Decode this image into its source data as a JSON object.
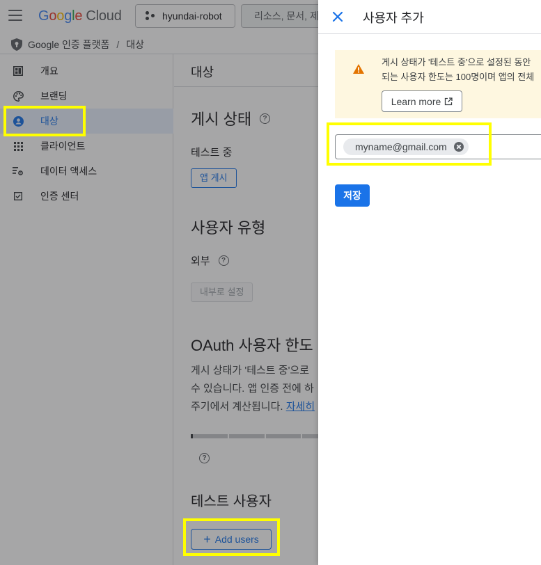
{
  "topbar": {
    "logo_word": "Google",
    "logo_cloud": "Cloud",
    "project": "hyundai-robot",
    "search_placeholder": "리소스, 문서, 제품"
  },
  "breadcrumb": {
    "items": [
      "Google 인증 플랫폼",
      "대상"
    ],
    "separator": "/"
  },
  "sidebar": {
    "items": [
      {
        "label": "개요",
        "icon": "dashboard-icon"
      },
      {
        "label": "브랜딩",
        "icon": "palette-icon"
      },
      {
        "label": "대상",
        "icon": "person-icon",
        "active": true
      },
      {
        "label": "클라이언트",
        "icon": "grid-icon"
      },
      {
        "label": "데이터 액세스",
        "icon": "data-access-icon"
      },
      {
        "label": "인증 센터",
        "icon": "checkbox-icon"
      }
    ]
  },
  "main": {
    "title": "대상",
    "publish_heading": "게시 상태",
    "publish_status": "테스트 중",
    "publish_button": "앱 게시",
    "user_type_heading": "사용자 유형",
    "user_type": "외부",
    "make_internal_button": "내부로 설정",
    "cap_heading": "OAuth 사용자 한도",
    "cap_line1": "게시 상태가 '테스트 중'으로",
    "cap_line2": "수 있습니다. 앱 인증 전에 하",
    "cap_line3": "주기에서 계산됩니다.",
    "cap_link": "자세히",
    "test_users_heading": "테스트 사용자",
    "add_users_button": "Add users"
  },
  "panel": {
    "title": "사용자 추가",
    "warning_line1": "게시 상태가 '테스트 중'으로 설정된 동안",
    "warning_line2": "되는 사용자 한도는 100명이며 앱의 전체",
    "learn_more": "Learn more",
    "email_chip": "myname@gmail.com",
    "save_button": "저장"
  },
  "colors": {
    "accent": "#1a73e8",
    "warning_bg": "#fef7e0",
    "warning_icon": "#e37400",
    "highlight": "#ffff00"
  }
}
